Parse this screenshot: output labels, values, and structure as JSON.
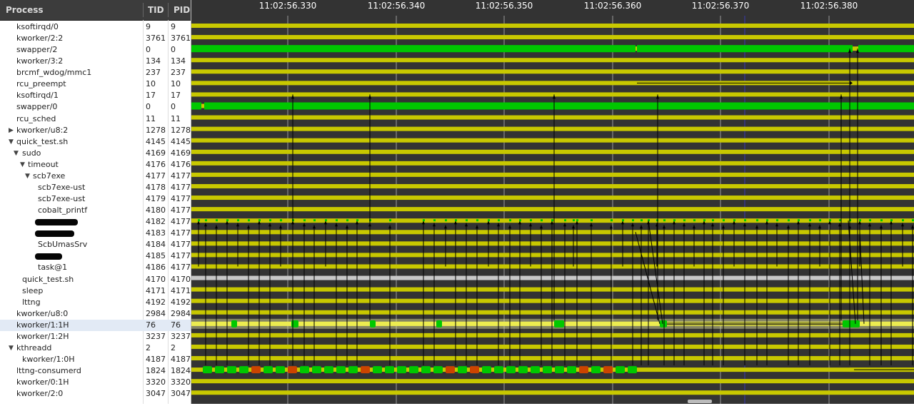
{
  "columns": {
    "process": "Process",
    "tid": "TID",
    "pid": "PID"
  },
  "time_labels": [
    "11:02:56.330",
    "11:02:56.340",
    "11:02:56.350",
    "11:02:56.360",
    "11:02:56.370",
    "11:02:56.380"
  ],
  "processes": [
    {
      "name": "ksoftirqd/0",
      "tid": "9",
      "pid": "9",
      "depth": 1,
      "arrow": ""
    },
    {
      "name": "kworker/2:2",
      "tid": "3761",
      "pid": "3761",
      "depth": 1,
      "arrow": ""
    },
    {
      "name": "swapper/2",
      "tid": "0",
      "pid": "0",
      "depth": 1,
      "arrow": ""
    },
    {
      "name": "kworker/3:2",
      "tid": "134",
      "pid": "134",
      "depth": 1,
      "arrow": ""
    },
    {
      "name": "brcmf_wdog/mmc1",
      "tid": "237",
      "pid": "237",
      "depth": 1,
      "arrow": ""
    },
    {
      "name": "rcu_preempt",
      "tid": "10",
      "pid": "10",
      "depth": 1,
      "arrow": ""
    },
    {
      "name": "ksoftirqd/1",
      "tid": "17",
      "pid": "17",
      "depth": 1,
      "arrow": ""
    },
    {
      "name": "swapper/0",
      "tid": "0",
      "pid": "0",
      "depth": 1,
      "arrow": ""
    },
    {
      "name": "rcu_sched",
      "tid": "11",
      "pid": "11",
      "depth": 1,
      "arrow": ""
    },
    {
      "name": "kworker/u8:2",
      "tid": "1278",
      "pid": "1278",
      "depth": 1,
      "arrow": "right"
    },
    {
      "name": "quick_test.sh",
      "tid": "4145",
      "pid": "4145",
      "depth": 1,
      "arrow": "down"
    },
    {
      "name": "sudo",
      "tid": "4169",
      "pid": "4169",
      "depth": 2,
      "arrow": "down"
    },
    {
      "name": "timeout",
      "tid": "4176",
      "pid": "4176",
      "depth": 3,
      "arrow": "down"
    },
    {
      "name": "scb7exe",
      "tid": "4177",
      "pid": "4177",
      "depth": 4,
      "arrow": "down"
    },
    {
      "name": "scb7exe-ust",
      "tid": "4178",
      "pid": "4177",
      "depth": 5,
      "arrow": ""
    },
    {
      "name": "scb7exe-ust",
      "tid": "4179",
      "pid": "4177",
      "depth": 5,
      "arrow": ""
    },
    {
      "name": "cobalt_printf",
      "tid": "4180",
      "pid": "4177",
      "depth": 5,
      "arrow": ""
    },
    {
      "name": "",
      "tid": "4182",
      "pid": "4177",
      "depth": 5,
      "arrow": "",
      "redacted": true
    },
    {
      "name": "",
      "tid": "4183",
      "pid": "4177",
      "depth": 5,
      "arrow": "",
      "redacted": true
    },
    {
      "name": "ScbUmasSrv",
      "tid": "4184",
      "pid": "4177",
      "depth": 5,
      "arrow": ""
    },
    {
      "name": "",
      "tid": "4185",
      "pid": "4177",
      "depth": 5,
      "arrow": "",
      "redacted": true
    },
    {
      "name": "task@1",
      "tid": "4186",
      "pid": "4177",
      "depth": 5,
      "arrow": ""
    },
    {
      "name": "quick_test.sh",
      "tid": "4170",
      "pid": "4170",
      "depth": 2,
      "arrow": ""
    },
    {
      "name": "sleep",
      "tid": "4171",
      "pid": "4171",
      "depth": 2,
      "arrow": ""
    },
    {
      "name": "lttng",
      "tid": "4192",
      "pid": "4192",
      "depth": 2,
      "arrow": ""
    },
    {
      "name": "kworker/u8:0",
      "tid": "2984",
      "pid": "2984",
      "depth": 1,
      "arrow": ""
    },
    {
      "name": "kworker/1:1H",
      "tid": "76",
      "pid": "76",
      "depth": 1,
      "arrow": "",
      "selected": true
    },
    {
      "name": "kworker/1:2H",
      "tid": "3237",
      "pid": "3237",
      "depth": 1,
      "arrow": ""
    },
    {
      "name": "kthreadd",
      "tid": "2",
      "pid": "2",
      "depth": 1,
      "arrow": "down"
    },
    {
      "name": "kworker/1:0H",
      "tid": "4187",
      "pid": "4187",
      "depth": 2,
      "arrow": ""
    },
    {
      "name": "lttng-consumerd",
      "tid": "1824",
      "pid": "1824",
      "depth": 1,
      "arrow": ""
    },
    {
      "name": "kworker/0:1H",
      "tid": "3320",
      "pid": "3320",
      "depth": 1,
      "arrow": ""
    },
    {
      "name": "kworker/2:0",
      "tid": "3047",
      "pid": "3047",
      "depth": 1,
      "arrow": ""
    }
  ],
  "colors": {
    "waiting": "#c8c800",
    "running": "#00c800",
    "preempted": "#cc4400",
    "unknown": "#c8c8c8",
    "selected_row": "#e2eaf5",
    "background": "#333333"
  }
}
